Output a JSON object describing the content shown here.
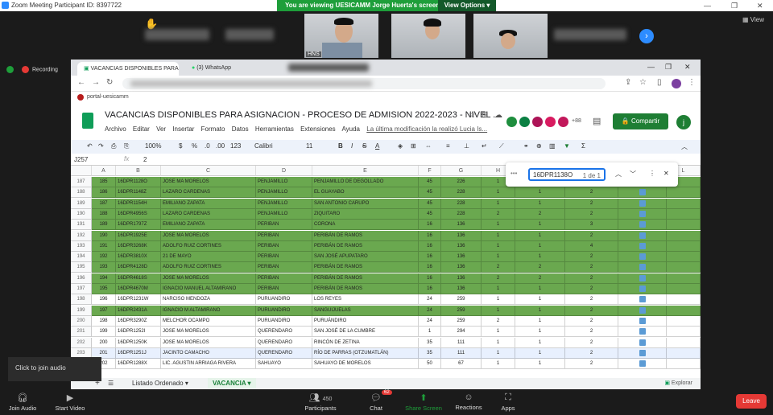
{
  "zoom": {
    "window_title": "Zoom Meeting Participant ID: 8397722",
    "banner": "You are viewing UESICAMM Jorge Huerta's screen",
    "view_options": "View Options ▾",
    "view_label": "View",
    "recording_label": "Recording",
    "participant_name": "HNS",
    "audio_tip": "Click to join audio",
    "participants_count": "450",
    "chat_badge": "62",
    "controls": {
      "join_audio": "Join Audio",
      "start_video": "Start Video",
      "participants": "Participants",
      "chat": "Chat",
      "share_screen": "Share Screen",
      "reactions": "Reactions",
      "apps": "Apps",
      "leave": "Leave"
    }
  },
  "browser": {
    "tab1": "VACANCIAS DISPONIBLES PARA",
    "tab2": "(3) WhatsApp",
    "bookmark": "portal-uesicamm"
  },
  "sheet": {
    "title": "VACANCIAS DISPONIBLES PARA ASIGNACION - PROCESO DE ADMISION 2022-2023 - NIVEL ...",
    "menu": [
      "Archivo",
      "Editar",
      "Ver",
      "Insertar",
      "Formato",
      "Datos",
      "Herramientas",
      "Extensiones",
      "Ayuda"
    ],
    "last_edit": "La última modificación la realizó Lucia Is...",
    "share_label": "Compartir",
    "avatar_more": "+88",
    "user_initial": "j",
    "toolbar": {
      "zoom": "100%",
      "currency": "$",
      "percent": "%",
      "dec1": ".0",
      "dec2": ".00",
      "num": "123",
      "font": "Calibri",
      "size": "11"
    },
    "cell_ref": "J257",
    "formula": "2",
    "find": {
      "query": "16DPR1138O",
      "count": "1 de 1"
    },
    "columns": [
      "A",
      "B",
      "C",
      "D",
      "E",
      "F",
      "G",
      "H",
      "I",
      "J",
      "K",
      "L"
    ],
    "rows": [
      {
        "rn": "187",
        "a": "185",
        "b": "16DPR1128O",
        "c": "JOSE MA MORELOS",
        "d": "PENJAMILLO",
        "e": "PENJAMILLO DE DEGOLLADO",
        "f": "45",
        "g": "226",
        "h": "1",
        "i": "1",
        "j": "2",
        "hl": true
      },
      {
        "rn": "188",
        "a": "186",
        "b": "16DPR1148Z",
        "c": "LAZARO CARDENAS",
        "d": "PENJAMILLO",
        "e": "EL GUAYABO",
        "f": "45",
        "g": "228",
        "h": "1",
        "i": "1",
        "j": "2",
        "hl": true
      },
      {
        "rn": "189",
        "a": "187",
        "b": "16DPR1154H",
        "c": "EMILIANO ZAPATA",
        "d": "PENJAMILLO",
        "e": "SAN ANTONIO CARUPO",
        "f": "45",
        "g": "228",
        "h": "1",
        "i": "1",
        "j": "2",
        "hl": true
      },
      {
        "rn": "190",
        "a": "188",
        "b": "16DPR4956S",
        "c": "LAZARO CARDENAS",
        "d": "PENJAMILLO",
        "e": "ZIQUITARO",
        "f": "45",
        "g": "228",
        "h": "2",
        "i": "2",
        "j": "2",
        "hl": true
      },
      {
        "rn": "191",
        "a": "189",
        "b": "16DPR1797Z",
        "c": "EMILIANO ZAPATA",
        "d": "PERIBAN",
        "e": "CORONA",
        "f": "16",
        "g": "136",
        "h": "1",
        "i": "1",
        "j": "3",
        "hl": true
      },
      {
        "rn": "192",
        "a": "190",
        "b": "16DPR1925E",
        "c": "JOSE MA MORELOS",
        "d": "PERIBAN",
        "e": "PERIBÁN DE RAMOS",
        "f": "16",
        "g": "136",
        "h": "1",
        "i": "1",
        "j": "2",
        "hl": true
      },
      {
        "rn": "193",
        "a": "191",
        "b": "16DPR3268K",
        "c": "ADOLFO RUIZ CORTINES",
        "d": "PERIBAN",
        "e": "PERIBÁN DE RAMOS",
        "f": "16",
        "g": "136",
        "h": "1",
        "i": "1",
        "j": "4",
        "hl": true
      },
      {
        "rn": "194",
        "a": "192",
        "b": "16DPR3810X",
        "c": "21 DE MAYO",
        "d": "PERIBAN",
        "e": "SAN JOSÉ APUPATARO",
        "f": "16",
        "g": "136",
        "h": "1",
        "i": "1",
        "j": "2",
        "hl": true
      },
      {
        "rn": "195",
        "a": "193",
        "b": "16DPR4128D",
        "c": "ADOLFO RUIZ CORTINES",
        "d": "PERIBAN",
        "e": "PERIBÁN DE RAMOS",
        "f": "16",
        "g": "136",
        "h": "2",
        "i": "2",
        "j": "2",
        "hl": true
      },
      {
        "rn": "196",
        "a": "194",
        "b": "16DPR4618S",
        "c": "JOSE MA MORELOS",
        "d": "PERIBAN",
        "e": "PERIBÁN DE RAMOS",
        "f": "16",
        "g": "136",
        "h": "2",
        "i": "2",
        "j": "2",
        "hl": true
      },
      {
        "rn": "197",
        "a": "195",
        "b": "16DPR4670M",
        "c": "IGNACIO MANUEL ALTAMIRANO",
        "d": "PERIBAN",
        "e": "PERIBÁN DE RAMOS",
        "f": "16",
        "g": "136",
        "h": "1",
        "i": "1",
        "j": "2",
        "hl": true
      },
      {
        "rn": "198",
        "a": "196",
        "b": "16DPR1231W",
        "c": "NARCISO MENDOZA",
        "d": "PURUANDIRO",
        "e": "LOS REYES",
        "f": "24",
        "g": "259",
        "h": "1",
        "i": "1",
        "j": "2",
        "hl": false
      },
      {
        "rn": "199",
        "a": "197",
        "b": "16DPR2431A",
        "c": "IGNACIO M ALTAMIRANO",
        "d": "PURUANDIRO",
        "e": "SANGUIJUELAS",
        "f": "24",
        "g": "259",
        "h": "1",
        "i": "1",
        "j": "2",
        "hl": true
      },
      {
        "rn": "200",
        "a": "198",
        "b": "16DPR3290Z",
        "c": "MELCHOR OCAMPO",
        "d": "PURUANDIRO",
        "e": "PURUÁNDIRO",
        "f": "24",
        "g": "259",
        "h": "2",
        "i": "1",
        "j": "2",
        "hl": false
      },
      {
        "rn": "201",
        "a": "199",
        "b": "16DPR1252I",
        "c": "JOSE MA MORELOS",
        "d": "QUERENDARO",
        "e": "SAN JOSÉ DE LA CUMBRE",
        "f": "1",
        "g": "294",
        "h": "1",
        "i": "1",
        "j": "2",
        "hl": false
      },
      {
        "rn": "202",
        "a": "200",
        "b": "16DPR1250K",
        "c": "JOSE MA MORELOS",
        "d": "QUERENDARO",
        "e": "RINCÓN DE ZETINA",
        "f": "35",
        "g": "111",
        "h": "1",
        "i": "1",
        "j": "2",
        "hl": false
      },
      {
        "rn": "203",
        "a": "201",
        "b": "16DPR1251J",
        "c": "JACINTO CAMACHO",
        "d": "QUERENDARO",
        "e": "RÍO DE PARRAS (OTZUMATLÁN)",
        "f": "35",
        "g": "111",
        "h": "1",
        "i": "1",
        "j": "2",
        "hl": false,
        "sel": true
      },
      {
        "rn": "204",
        "a": "202",
        "b": "16DPR1288X",
        "c": "LIC. AGUSTIN ARRIAGA RIVERA",
        "d": "SAHUAYO",
        "e": "SAHUAYO DE MORELOS",
        "f": "50",
        "g": "67",
        "h": "1",
        "i": "1",
        "j": "2",
        "hl": false
      }
    ],
    "sheet_tabs": [
      "Listado Ordenado ▾",
      "VACANCIA ▾"
    ],
    "explore": "Explorar"
  },
  "colors": {
    "highlight": "#6aa84f",
    "zoom_green": "#1e9e3a",
    "leave": "#e53935",
    "zoom_blue": "#2d8cff"
  }
}
